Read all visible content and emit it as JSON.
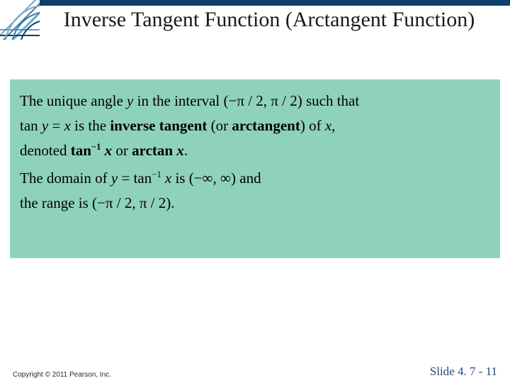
{
  "title": "Inverse Tangent Function (Arctangent Function)",
  "definition": {
    "line1_prefix": "The unique angle ",
    "line1_y": "y",
    "line1_mid": " in the interval ",
    "line1_interval": "(−π / 2, π / 2)",
    "line1_suffix": " such that",
    "line2_prefix": "tan ",
    "line2_y": "y",
    "line2_eq": " = ",
    "line2_x": "x",
    "line2_mid": " is the ",
    "line2_bold1": "inverse tangent",
    "line2_or": " (or ",
    "line2_bold2": "arctangent",
    "line2_of": ") of ",
    "line2_x2": "x",
    "line2_end": ",",
    "line3_prefix": "denoted ",
    "line3_bold1a": "tan",
    "line3_sup": "−1",
    "line3_bold1b": " x",
    "line3_or": " or ",
    "line3_bold2": "arctan ",
    "line3_bold2x": "x",
    "line3_end": ".",
    "line4_prefix": "The domain of ",
    "line4_y": "y",
    "line4_eq": " = tan",
    "line4_sup": "−1",
    "line4_x": " x",
    "line4_is": " is ",
    "line4_dom": "(−∞, ∞)",
    "line4_and": " and",
    "line5_prefix": "the range is ",
    "line5_range": "(−π / 2, π / 2)",
    "line5_end": "."
  },
  "footer": {
    "copyright": "Copyright © 2011 Pearson, Inc.",
    "slide_label": "Slide 4. 7 - 11"
  },
  "colors": {
    "accent_bar": "#0e3e6a",
    "box_bg": "#8fd2bb",
    "slidenum": "#244a7a"
  }
}
